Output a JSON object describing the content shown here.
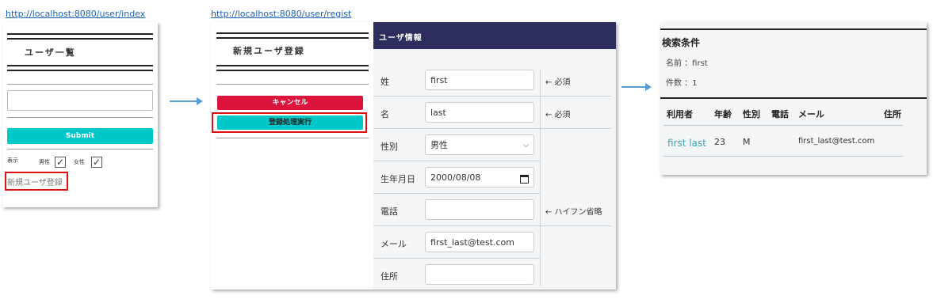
{
  "urls": {
    "index": "http://localhost:8080/user/index",
    "regist": "http://localhost:8080/user/regist"
  },
  "index": {
    "title": "ユーザ一覧",
    "search_value": "",
    "submit_label": "Submit",
    "filter_label": "表示",
    "male_label": "男性",
    "female_label": "女性",
    "male_checked": true,
    "female_checked": true,
    "new_link": "新規ユーザ登録"
  },
  "regist": {
    "title": "新規ユーザ登録",
    "cancel_label": "キャンセル",
    "submit_label": "登録処理実行",
    "panel_title": "ユーザ情報",
    "fields": [
      {
        "label": "姓",
        "value": "first",
        "note": "← 必須"
      },
      {
        "label": "名",
        "value": "last",
        "note": "← 必須"
      },
      {
        "label": "性別",
        "value": "男性",
        "note": ""
      },
      {
        "label": "生年月日",
        "value": "2000/08/08",
        "note": ""
      },
      {
        "label": "電話",
        "value": "",
        "note": "← ハイフン省略"
      },
      {
        "label": "メール",
        "value": "first_last@test.com",
        "note": ""
      },
      {
        "label": "住所",
        "value": "",
        "note": ""
      }
    ]
  },
  "result": {
    "title": "検索条件",
    "name_line": "名前 ：first",
    "count_line": "件数 ：1",
    "headers": [
      "利用者",
      "年齢",
      "性別",
      "電話",
      "メール",
      "住所"
    ],
    "rows": [
      {
        "user": "first last",
        "age": "23",
        "gender": "M",
        "phone": "",
        "mail": "first_last@test.com",
        "address": ""
      }
    ]
  },
  "colors": {
    "cancel": "#dc143c",
    "submit": "#00c8c8",
    "header_bg": "#2d2d5e",
    "highlight": "#d11",
    "link": "#3aa6b0",
    "arrow": "#5a9bd4"
  }
}
